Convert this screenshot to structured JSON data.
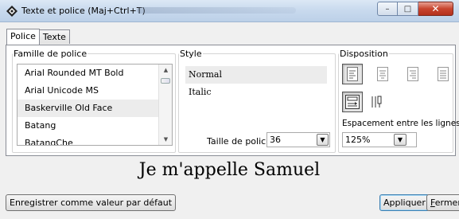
{
  "window": {
    "title": "Texte et police (Maj+Ctrl+T)",
    "icon": "app-diamond-icon",
    "controls": {
      "minimize": "–",
      "maximize": "□",
      "close": "✕"
    }
  },
  "tabs": [
    {
      "label": "Police",
      "active": true
    },
    {
      "label": "Texte",
      "active": false
    }
  ],
  "family": {
    "legend": "Famille de police",
    "items": [
      "Arial Rounded MT Bold",
      "Arial Unicode MS",
      "Baskerville Old Face",
      "Batang",
      "BatangChe"
    ],
    "selected": "Baskerville Old Face"
  },
  "style": {
    "legend": "Style",
    "items": [
      "Normal",
      "Italic"
    ],
    "selected": "Normal",
    "size_label": "Taille de police :",
    "size_value": "36"
  },
  "disposition": {
    "legend": "Disposition",
    "alignment_buttons": [
      "align-left-icon",
      "align-center-icon",
      "align-right-icon",
      "align-justify-icon"
    ],
    "active_alignment": "align-left-icon",
    "mode_buttons": [
      "horizontal-text-icon",
      "vertical-text-icon"
    ],
    "active_mode": "horizontal-text-icon",
    "spacing_label": "Espacement entre les lignes :",
    "spacing_value": "125%"
  },
  "preview": {
    "text": "Je m'appelle Samuel"
  },
  "buttons": {
    "save_default": "Enregistrer comme valeur par défaut",
    "apply": "Appliquer",
    "close_prefix": "F",
    "close_rest": "ermer"
  },
  "colors": {
    "titlebar": "#c9daee",
    "selection": "#ececec",
    "close_button": "#c8452f",
    "default_button_border": "#3c7fb1"
  }
}
